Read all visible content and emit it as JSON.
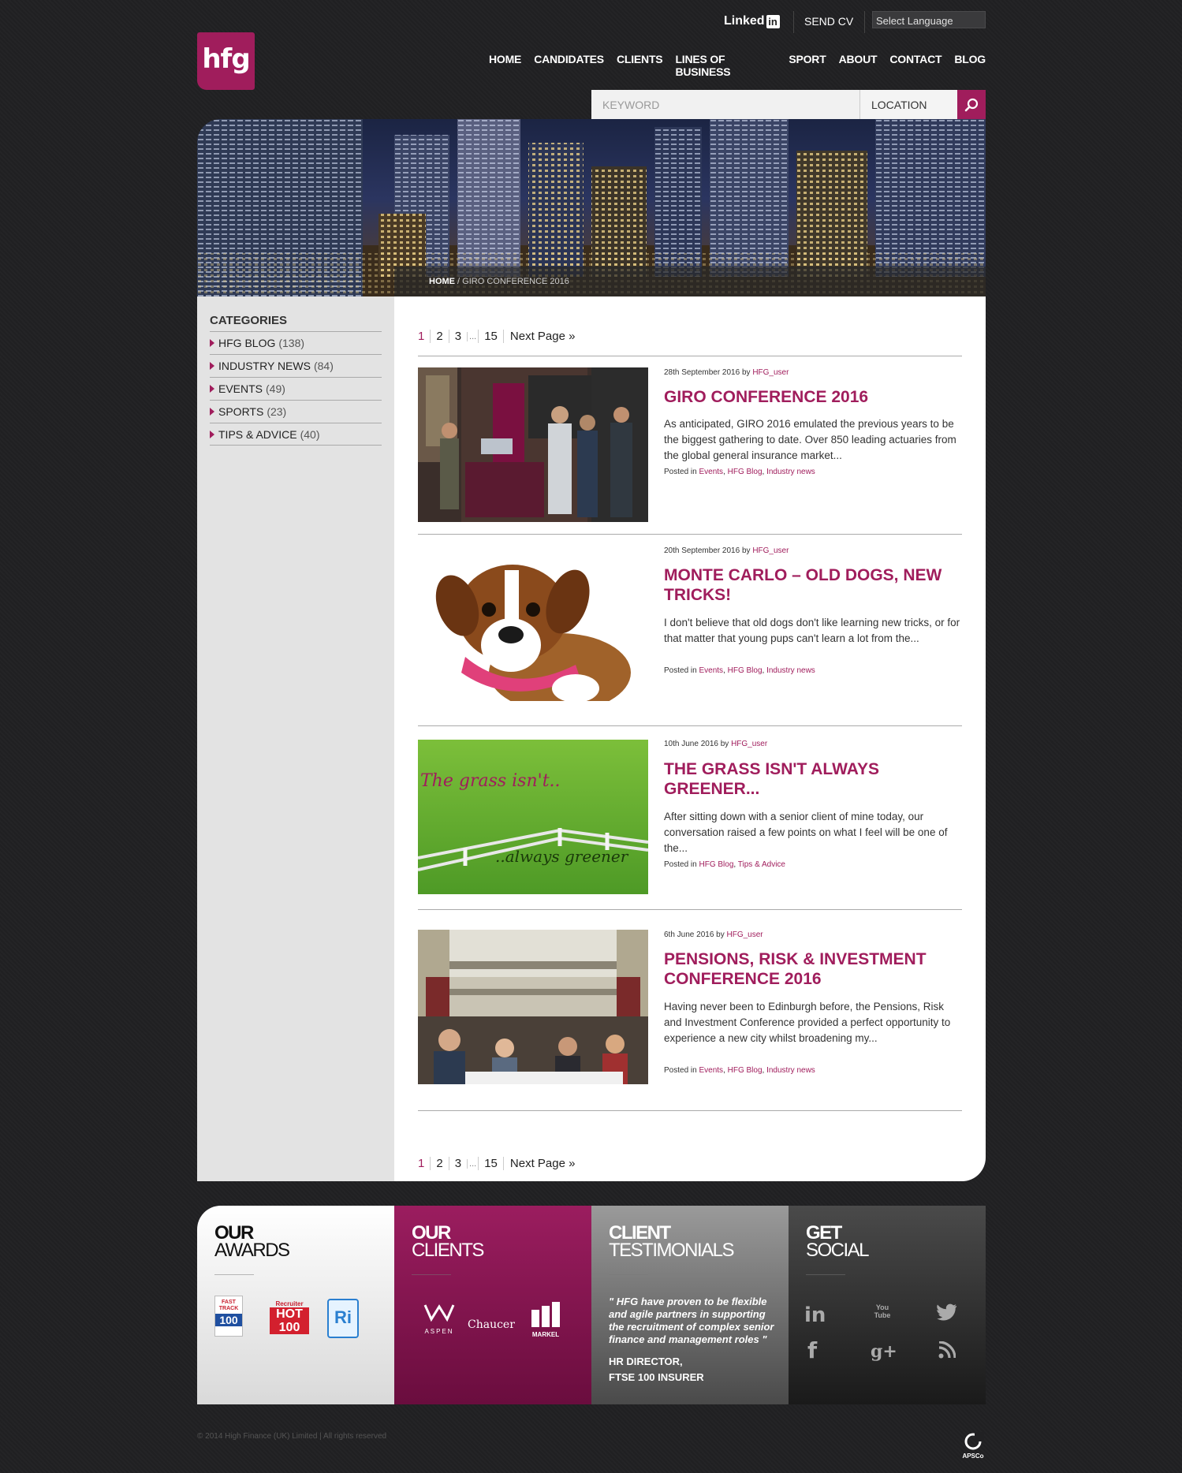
{
  "header": {
    "linkedin": "Linked",
    "linkedin_in": "in",
    "send_cv": "SEND CV",
    "language": "Select Language",
    "logo": "hfg",
    "nav": [
      "HOME",
      "CANDIDATES",
      "CLIENTS",
      "LINES OF BUSINESS",
      "SPORT",
      "ABOUT",
      "CONTACT",
      "BLOG"
    ],
    "search": {
      "keyword_placeholder": "KEYWORD",
      "location_placeholder": "LOCATION"
    }
  },
  "breadcrumb": {
    "home": "HOME",
    "separator": " / ",
    "current": "GIRO CONFERENCE 2016"
  },
  "sidebar": {
    "title": "CATEGORIES",
    "items": [
      {
        "label": "HFG BLOG",
        "count": "(138)"
      },
      {
        "label": "INDUSTRY NEWS",
        "count": "(84)"
      },
      {
        "label": "EVENTS",
        "count": "(49)"
      },
      {
        "label": "SPORTS",
        "count": "(23)"
      },
      {
        "label": "TIPS & ADVICE",
        "count": "(40)"
      }
    ]
  },
  "pagination": {
    "pages": [
      "1",
      "2",
      "3"
    ],
    "dots": "...",
    "last": "15",
    "next": "Next Page »"
  },
  "posts": [
    {
      "date": "28th September 2016",
      "by": "by",
      "author": "HFG_user",
      "title": "GIRO CONFERENCE 2016",
      "excerpt": "As anticipated, GIRO 2016 emulated the previous years to be the biggest gathering to date. Over 850 leading actuaries from the global general insurance market...",
      "posted_in": "Posted in",
      "tags": [
        "Events",
        "HFG Blog",
        "Industry news"
      ]
    },
    {
      "date": "20th September 2016",
      "by": "by",
      "author": "HFG_user",
      "title": "MONTE CARLO – OLD DOGS, NEW TRICKS!",
      "excerpt": "  I don't believe that old dogs don't like learning new tricks, or for that matter that young pups can't learn a lot from the...",
      "posted_in": "Posted in",
      "tags": [
        "Events",
        "HFG Blog",
        "Industry news"
      ]
    },
    {
      "date": "10th June 2016",
      "by": "by",
      "author": "HFG_user",
      "title": "THE GRASS ISN'T ALWAYS GREENER...",
      "excerpt": "After sitting down with a senior client of mine today, our conversation raised a few points on what I feel will be one of the...",
      "posted_in": "Posted in",
      "tags": [
        "HFG Blog",
        "Tips & Advice"
      ],
      "image_text": {
        "top": "The grass isn't..",
        "bottom": "..always greener"
      }
    },
    {
      "date": "6th June 2016",
      "by": "by",
      "author": "HFG_user",
      "title": "PENSIONS, RISK & INVESTMENT CONFERENCE 2016",
      "excerpt": "  Having never been to Edinburgh before, the Pensions, Risk and Investment Conference provided a perfect opportunity to experience a new city whilst broadening my...",
      "posted_in": "Posted in",
      "tags": [
        "Events",
        "HFG Blog",
        "Industry news"
      ]
    }
  ],
  "footer": {
    "awards": {
      "title_bold": "OUR",
      "title": "AWARDS",
      "badges": [
        {
          "line1": "FAST",
          "line2": "TRACK",
          "num": "100"
        },
        {
          "line1": "Recruiter",
          "num": "HOT 100"
        },
        {
          "line1": "Ri"
        }
      ]
    },
    "clients": {
      "title_bold": "OUR",
      "title": "CLIENTS",
      "logos": [
        "ASPEN",
        "Chaucer",
        "MARKEL"
      ]
    },
    "testimonials": {
      "title_bold": "CLIENT",
      "title": "TESTIMONIALS",
      "quote": "\" HFG have proven to be flexible and agile partners in supporting the recruitment of complex senior finance and management roles \"",
      "author_line1": "HR DIRECTOR,",
      "author_line2": "FTSE 100 INSURER"
    },
    "social": {
      "title_bold": "GET",
      "title": "SOCIAL",
      "youtube": "You Tube"
    },
    "copyright": "© 2014 High Finance (UK) Limited | All rights reserved",
    "apsco": "APSCo"
  },
  "colors": {
    "brand": "#a01d5c",
    "background": "#212123"
  }
}
